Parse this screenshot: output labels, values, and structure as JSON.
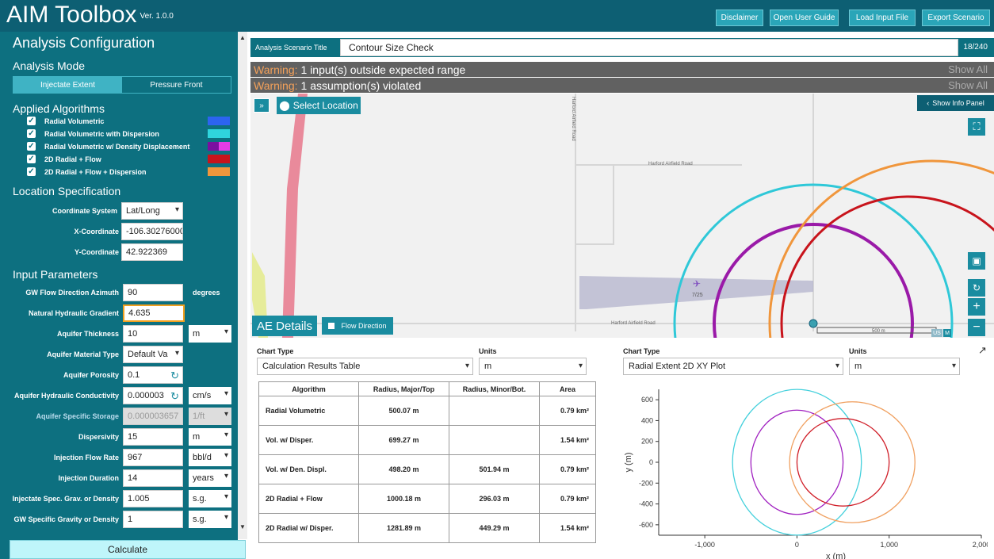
{
  "header": {
    "title": "AIM Toolbox",
    "version": "Ver. 1.0.0",
    "buttons": [
      "Disclaimer",
      "Open User Guide",
      "Load Input File",
      "Export Scenario"
    ]
  },
  "sidebar": {
    "title": "Analysis Configuration",
    "mode_heading": "Analysis Mode",
    "modes": [
      "Injectate Extent",
      "Pressure Front"
    ],
    "active_mode": "Injectate Extent",
    "algorithms_heading": "Applied Algorithms",
    "algorithms": [
      {
        "label": "Radial Volumetric",
        "checked": true,
        "color": "#2c64f0"
      },
      {
        "label": "Radial Volumetric with Dispersion",
        "checked": true,
        "color": "#2fd4dd"
      },
      {
        "label": "Radial Volumetric w/ Density Displacement",
        "checked": true,
        "color": "#7b0fa0",
        "color2": "#e63ce6"
      },
      {
        "label": "2D Radial + Flow",
        "checked": true,
        "color": "#c8141c"
      },
      {
        "label": "2D Radial + Flow + Dispersion",
        "checked": true,
        "color": "#f0963c"
      }
    ],
    "location_heading": "Location Specification",
    "location": {
      "coord_system_label": "Coordinate System",
      "coord_system_value": "Lat/Long",
      "x_label": "X-Coordinate",
      "x_value": "-106.302760000000",
      "y_label": "Y-Coordinate",
      "y_value": "42.922369"
    },
    "input_heading": "Input Parameters",
    "inputs": [
      {
        "label": "GW Flow Direction Azimuth",
        "value": "90",
        "unit": "degrees"
      },
      {
        "label": "Natural Hydraulic Gradient",
        "value": "4.635",
        "unit": ""
      },
      {
        "label": "Aquifer Thickness",
        "value": "10",
        "unit": "m"
      },
      {
        "label": "Aquifer Material Type",
        "value": "Default Va",
        "unit": ""
      },
      {
        "label": "Aquifer Porosity",
        "value": "0.1",
        "unit": ""
      },
      {
        "label": "Aquifer Hydraulic Conductivity",
        "value": "0.000003",
        "unit": "cm/s"
      },
      {
        "label": "Aquifer Specific Storage",
        "value": "0.000003657",
        "unit": "1/ft"
      },
      {
        "label": "Dispersivity",
        "value": "15",
        "unit": "m"
      },
      {
        "label": "Injection Flow Rate",
        "value": "967",
        "unit": "bbl/d"
      },
      {
        "label": "Injection Duration",
        "value": "14",
        "unit": "years"
      },
      {
        "label": "Injectate Spec. Grav. or Density",
        "value": "1.005",
        "unit": "s.g."
      },
      {
        "label": "GW Specific Gravity or Density",
        "value": "1",
        "unit": "s.g."
      }
    ],
    "calculate_label": "Calculate"
  },
  "scenario": {
    "label": "Analysis Scenario Title",
    "value": "Contour Size Check",
    "char_count": "18/240"
  },
  "warnings": [
    {
      "prefix": "Warning:",
      "text": "1 input(s) outside expected range",
      "action": "Show All"
    },
    {
      "prefix": "Warning:",
      "text": "1 assumption(s) violated",
      "action": "Show All"
    }
  ],
  "map": {
    "select_location": "Select Location",
    "show_info_panel": "Show Info Panel",
    "ae_details": "AE Details",
    "flow_direction": "Flow Direction",
    "road1": "Harford Airfield Road",
    "road2": "Harford Airfield Road",
    "road3": "Harford Airfield Road",
    "runway": "7/25",
    "scale": "500 m",
    "scale_units": [
      "US",
      "M"
    ]
  },
  "results": {
    "chart_type_label": "Chart Type",
    "chart_type_value": "Calculation Results Table",
    "units_label": "Units",
    "units_value": "m",
    "columns": [
      "Algorithm",
      "Radius, Major/Top",
      "Radius, Minor/Bot.",
      "Area"
    ],
    "rows": [
      [
        "Radial Volumetric",
        "500.07 m",
        "",
        "0.79 km²"
      ],
      [
        "Vol. w/ Disper.",
        "699.27 m",
        "",
        "1.54 km²"
      ],
      [
        "Vol. w/ Den. Displ.",
        "498.20 m",
        "501.94 m",
        "0.79 km²"
      ],
      [
        "2D Radial + Flow",
        "1000.18 m",
        "296.03 m",
        "0.79 km²"
      ],
      [
        "2D Radial w/ Disper.",
        "1281.89 m",
        "449.29 m",
        "1.54 km²"
      ]
    ]
  },
  "plot": {
    "chart_type_label": "Chart Type",
    "chart_type_value": "Radial Extent 2D XY Plot",
    "units_label": "Units",
    "units_value": "m"
  },
  "chart_data": {
    "type": "scatter",
    "title": "",
    "xlabel": "x (m)",
    "ylabel": "y (m)",
    "xlim": [
      -1500,
      2000
    ],
    "ylim": [
      -700,
      700
    ],
    "xticks": [
      -1000,
      0,
      1000,
      2000
    ],
    "xtick_labels": [
      "-1,000",
      "0",
      "1,000",
      "2,000"
    ],
    "yticks": [
      -600,
      -400,
      -200,
      0,
      200,
      400,
      600
    ],
    "ytick_labels": [
      "-600",
      "-400",
      "-200",
      "0",
      "200",
      "400",
      "600"
    ],
    "grid": false,
    "series": [
      {
        "shape": "ellipse",
        "center": [
          0,
          0
        ],
        "rx": 699,
        "ry": 699,
        "color": "#44d0dc"
      },
      {
        "shape": "ellipse",
        "center": [
          0,
          0
        ],
        "rx": 500,
        "ry": 500,
        "color": "#a020c0"
      },
      {
        "shape": "ellipse",
        "center": [
          600,
          0
        ],
        "rx": 680,
        "ry": 580,
        "color": "#f0a060"
      },
      {
        "shape": "ellipse",
        "center": [
          500,
          0
        ],
        "rx": 500,
        "ry": 420,
        "color": "#d01e28"
      }
    ]
  }
}
